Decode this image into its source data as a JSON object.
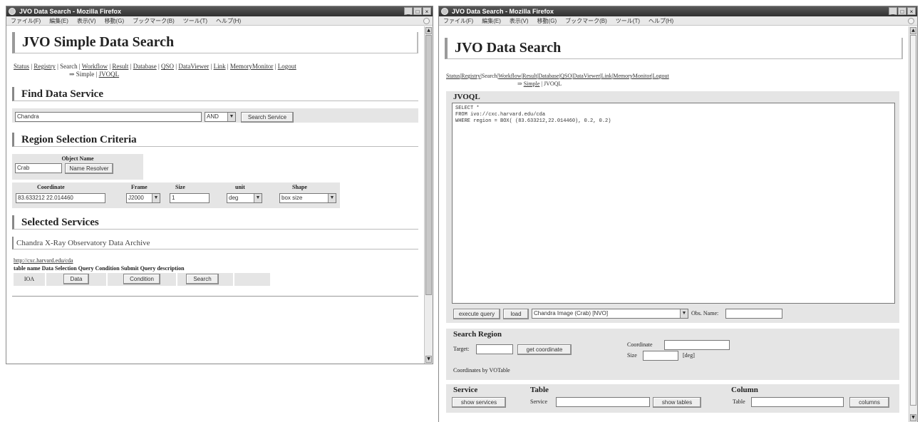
{
  "left": {
    "title": "JVO Data Search - Mozilla Firefox",
    "menu": [
      "ファイル(F)",
      "編集(E)",
      "表示(V)",
      "移動(G)",
      "ブックマーク(B)",
      "ツール(T)",
      "ヘルプ(H)"
    ],
    "page_title": "JVO Simple Data Search",
    "nav": [
      "Status",
      "Registry",
      "Search",
      "Workflow",
      "Result",
      "Database",
      "QSO",
      "DataViewer",
      "Link",
      "MemoryMonitor",
      "Logout"
    ],
    "sub_prefix": "⇒ Simple |",
    "sub_link": "JVOQL",
    "find": {
      "heading": "Find Data Service",
      "keyword": "Chandra",
      "op": "AND",
      "search_btn": "Search Service"
    },
    "region": {
      "heading": "Region Selection Criteria",
      "object_name_label": "Object Name",
      "object_value": "Crab",
      "resolver_btn": "Name Resolver",
      "cols": [
        "Coordinate",
        "Frame",
        "Size",
        "unit",
        "Shape"
      ],
      "coordinate": "83.633212 22.014460",
      "frame": "J2000",
      "size": "1",
      "unit": "deg",
      "shape": "box size"
    },
    "selected": {
      "heading": "Selected Services",
      "service_name": "Chandra X-Ray Observatory Data Archive",
      "link": "http://cxc.harvard.edu/cda",
      "cols": [
        "table name",
        "Data Selection",
        "Query Condition",
        "Submit Query",
        "description"
      ],
      "row": {
        "table": "IOA",
        "data_btn": "Data",
        "cond_btn": "Condition",
        "search_btn": "Search"
      }
    }
  },
  "right": {
    "title": "JVO Data Search - Mozilla Firefox",
    "menu": [
      "ファイル(F)",
      "編集(E)",
      "表示(V)",
      "移動(G)",
      "ブックマーク(B)",
      "ツール(T)",
      "ヘルプ(H)"
    ],
    "page_title": "JVO Data Search",
    "nav": [
      "Status",
      "Registry",
      "Search",
      "Workflow",
      "Result",
      "Database",
      "QSO",
      "DataViewer",
      "Link",
      "MemoryMonitor",
      "Logout"
    ],
    "sub_prefix": "⇒",
    "sub_link": "Simple",
    "sub_suffix": "| JVOQL",
    "jvoql": {
      "heading": "JVOQL",
      "query_lines": [
        "SELECT *",
        "FROM ivo://cxc.harvard.edu/cda",
        "WHERE region = BOX( (83.633212,22.014460), 0.2, 0.2)"
      ],
      "execute_btn": "execute query",
      "load_btn": "load",
      "saved_query": "Chandra Image (Crab) [NVO]",
      "obs_label": "Obs. Name:",
      "obs_value": ""
    },
    "search_region": {
      "heading": "Search Region",
      "target_label": "Target:",
      "target_value": "",
      "get_coord_btn": "get coordinate",
      "coord_label": "Coordinate",
      "coord_value": "",
      "size_label": "Size",
      "size_value": "",
      "size_unit": "[deg]",
      "votable_label": "Coordinates by VOTable"
    },
    "service": {
      "service_heading": "Service",
      "table_heading": "Table",
      "column_heading": "Column",
      "show_services_btn": "show services",
      "service_label": "Service",
      "service_value": "",
      "show_tables_btn": "show tables",
      "table_label": "Table",
      "table_value": "",
      "columns_btn": "columns"
    }
  }
}
